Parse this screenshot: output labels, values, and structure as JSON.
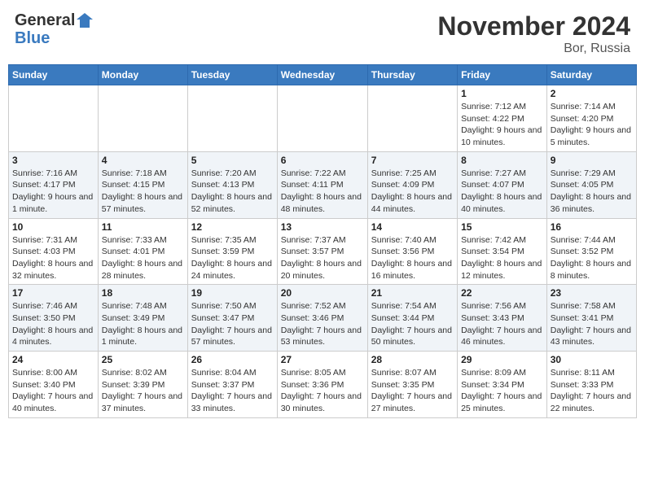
{
  "header": {
    "logo_general": "General",
    "logo_blue": "Blue",
    "month": "November 2024",
    "location": "Bor, Russia"
  },
  "days_of_week": [
    "Sunday",
    "Monday",
    "Tuesday",
    "Wednesday",
    "Thursday",
    "Friday",
    "Saturday"
  ],
  "weeks": [
    [
      {
        "day": "",
        "info": ""
      },
      {
        "day": "",
        "info": ""
      },
      {
        "day": "",
        "info": ""
      },
      {
        "day": "",
        "info": ""
      },
      {
        "day": "",
        "info": ""
      },
      {
        "day": "1",
        "info": "Sunrise: 7:12 AM\nSunset: 4:22 PM\nDaylight: 9 hours and 10 minutes."
      },
      {
        "day": "2",
        "info": "Sunrise: 7:14 AM\nSunset: 4:20 PM\nDaylight: 9 hours and 5 minutes."
      }
    ],
    [
      {
        "day": "3",
        "info": "Sunrise: 7:16 AM\nSunset: 4:17 PM\nDaylight: 9 hours and 1 minute."
      },
      {
        "day": "4",
        "info": "Sunrise: 7:18 AM\nSunset: 4:15 PM\nDaylight: 8 hours and 57 minutes."
      },
      {
        "day": "5",
        "info": "Sunrise: 7:20 AM\nSunset: 4:13 PM\nDaylight: 8 hours and 52 minutes."
      },
      {
        "day": "6",
        "info": "Sunrise: 7:22 AM\nSunset: 4:11 PM\nDaylight: 8 hours and 48 minutes."
      },
      {
        "day": "7",
        "info": "Sunrise: 7:25 AM\nSunset: 4:09 PM\nDaylight: 8 hours and 44 minutes."
      },
      {
        "day": "8",
        "info": "Sunrise: 7:27 AM\nSunset: 4:07 PM\nDaylight: 8 hours and 40 minutes."
      },
      {
        "day": "9",
        "info": "Sunrise: 7:29 AM\nSunset: 4:05 PM\nDaylight: 8 hours and 36 minutes."
      }
    ],
    [
      {
        "day": "10",
        "info": "Sunrise: 7:31 AM\nSunset: 4:03 PM\nDaylight: 8 hours and 32 minutes."
      },
      {
        "day": "11",
        "info": "Sunrise: 7:33 AM\nSunset: 4:01 PM\nDaylight: 8 hours and 28 minutes."
      },
      {
        "day": "12",
        "info": "Sunrise: 7:35 AM\nSunset: 3:59 PM\nDaylight: 8 hours and 24 minutes."
      },
      {
        "day": "13",
        "info": "Sunrise: 7:37 AM\nSunset: 3:57 PM\nDaylight: 8 hours and 20 minutes."
      },
      {
        "day": "14",
        "info": "Sunrise: 7:40 AM\nSunset: 3:56 PM\nDaylight: 8 hours and 16 minutes."
      },
      {
        "day": "15",
        "info": "Sunrise: 7:42 AM\nSunset: 3:54 PM\nDaylight: 8 hours and 12 minutes."
      },
      {
        "day": "16",
        "info": "Sunrise: 7:44 AM\nSunset: 3:52 PM\nDaylight: 8 hours and 8 minutes."
      }
    ],
    [
      {
        "day": "17",
        "info": "Sunrise: 7:46 AM\nSunset: 3:50 PM\nDaylight: 8 hours and 4 minutes."
      },
      {
        "day": "18",
        "info": "Sunrise: 7:48 AM\nSunset: 3:49 PM\nDaylight: 8 hours and 1 minute."
      },
      {
        "day": "19",
        "info": "Sunrise: 7:50 AM\nSunset: 3:47 PM\nDaylight: 7 hours and 57 minutes."
      },
      {
        "day": "20",
        "info": "Sunrise: 7:52 AM\nSunset: 3:46 PM\nDaylight: 7 hours and 53 minutes."
      },
      {
        "day": "21",
        "info": "Sunrise: 7:54 AM\nSunset: 3:44 PM\nDaylight: 7 hours and 50 minutes."
      },
      {
        "day": "22",
        "info": "Sunrise: 7:56 AM\nSunset: 3:43 PM\nDaylight: 7 hours and 46 minutes."
      },
      {
        "day": "23",
        "info": "Sunrise: 7:58 AM\nSunset: 3:41 PM\nDaylight: 7 hours and 43 minutes."
      }
    ],
    [
      {
        "day": "24",
        "info": "Sunrise: 8:00 AM\nSunset: 3:40 PM\nDaylight: 7 hours and 40 minutes."
      },
      {
        "day": "25",
        "info": "Sunrise: 8:02 AM\nSunset: 3:39 PM\nDaylight: 7 hours and 37 minutes."
      },
      {
        "day": "26",
        "info": "Sunrise: 8:04 AM\nSunset: 3:37 PM\nDaylight: 7 hours and 33 minutes."
      },
      {
        "day": "27",
        "info": "Sunrise: 8:05 AM\nSunset: 3:36 PM\nDaylight: 7 hours and 30 minutes."
      },
      {
        "day": "28",
        "info": "Sunrise: 8:07 AM\nSunset: 3:35 PM\nDaylight: 7 hours and 27 minutes."
      },
      {
        "day": "29",
        "info": "Sunrise: 8:09 AM\nSunset: 3:34 PM\nDaylight: 7 hours and 25 minutes."
      },
      {
        "day": "30",
        "info": "Sunrise: 8:11 AM\nSunset: 3:33 PM\nDaylight: 7 hours and 22 minutes."
      }
    ]
  ]
}
